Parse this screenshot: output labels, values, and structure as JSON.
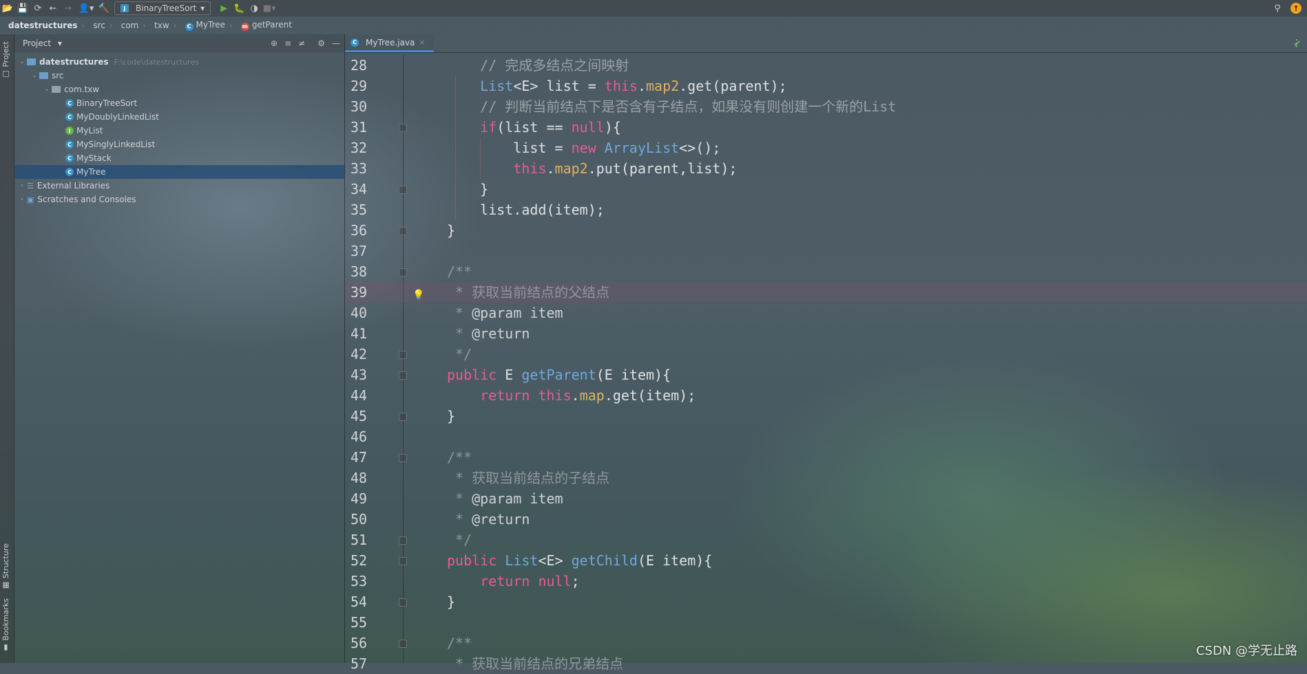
{
  "toolbar": {
    "icons": [
      "open-icon",
      "save-icon",
      "sync-icon",
      "back-icon",
      "forward-icon",
      "user-icon",
      "build-icon"
    ],
    "run_config": "BinaryTreeSort",
    "run_icons": [
      "run-icon",
      "debug-icon",
      "coverage-icon",
      "stop-icon"
    ]
  },
  "breadcrumb": {
    "items": [
      "datestructures",
      "src",
      "com",
      "txw",
      "MyTree",
      "getParent"
    ]
  },
  "sidebar_stripe": {
    "top_tab": "Project",
    "structure_tab": "Structure",
    "bookmarks_tab": "Bookmarks"
  },
  "project": {
    "header": "Project",
    "root": {
      "name": "datestructures",
      "path": "F:\\code\\datestructures"
    },
    "src": "src",
    "package": "com.txw",
    "files": [
      {
        "name": "BinaryTreeSort",
        "kind": "class",
        "badge": "C"
      },
      {
        "name": "MyDoublyLinkedList",
        "kind": "class",
        "badge": "C"
      },
      {
        "name": "MyList",
        "kind": "interface",
        "badge": "I"
      },
      {
        "name": "MySinglyLinkedList",
        "kind": "class",
        "badge": "C"
      },
      {
        "name": "MyStack",
        "kind": "class",
        "badge": "C"
      },
      {
        "name": "MyTree",
        "kind": "class",
        "badge": "C",
        "selected": true
      }
    ],
    "external_libraries": "External Libraries",
    "scratches": "Scratches and Consoles"
  },
  "editor": {
    "tab": "MyTree.java",
    "highlighted_line": 39,
    "lines": [
      {
        "n": "28",
        "text": "    // 完成多结点之间映射"
      },
      {
        "n": "29",
        "text": "    List<E> list = this.map2.get(parent);"
      },
      {
        "n": "30",
        "text": "    // 判断当前结点下是否含有子结点，如果没有则创建一个新的List"
      },
      {
        "n": "31",
        "text": "    if(list == null){"
      },
      {
        "n": "32",
        "text": "        list = new ArrayList<>();"
      },
      {
        "n": "33",
        "text": "        this.map2.put(parent,list);"
      },
      {
        "n": "34",
        "text": "    }"
      },
      {
        "n": "35",
        "text": "    list.add(item);"
      },
      {
        "n": "36",
        "text": "}"
      },
      {
        "n": "37",
        "text": ""
      },
      {
        "n": "38",
        "text": "/**"
      },
      {
        "n": "39",
        "text": " * 获取当前结点的父结点"
      },
      {
        "n": "40",
        "text": " * @param item"
      },
      {
        "n": "41",
        "text": " * @return"
      },
      {
        "n": "42",
        "text": " */"
      },
      {
        "n": "43",
        "text": "public E getParent(E item){"
      },
      {
        "n": "44",
        "text": "    return this.map.get(item);"
      },
      {
        "n": "45",
        "text": "}"
      },
      {
        "n": "46",
        "text": ""
      },
      {
        "n": "47",
        "text": "/**"
      },
      {
        "n": "48",
        "text": " * 获取当前结点的子结点"
      },
      {
        "n": "49",
        "text": " * @param item"
      },
      {
        "n": "50",
        "text": " * @return"
      },
      {
        "n": "51",
        "text": " */"
      },
      {
        "n": "52",
        "text": "public List<E> getChild(E item){"
      },
      {
        "n": "53",
        "text": "    return null;"
      },
      {
        "n": "54",
        "text": "}"
      },
      {
        "n": "55",
        "text": ""
      },
      {
        "n": "56",
        "text": "/**"
      },
      {
        "n": "57",
        "text": " * 获取当前结点的兄弟结点"
      }
    ]
  },
  "watermark": "CSDN @学无止路"
}
